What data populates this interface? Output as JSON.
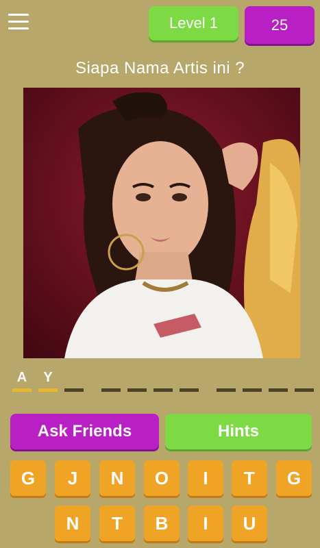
{
  "header": {
    "level_label": "Level 1",
    "coins": "25"
  },
  "question": "Siapa Nama Artis ini ?",
  "answer": {
    "slots": [
      "A",
      "Y",
      "",
      "",
      "",
      "",
      "",
      "",
      "",
      "",
      "",
      ""
    ]
  },
  "buttons": {
    "ask_friends": "Ask Friends",
    "hints": "Hints"
  },
  "keyboard": {
    "row1": [
      "G",
      "J",
      "N",
      "O",
      "I",
      "T",
      "G"
    ],
    "row2": [
      "N",
      "T",
      "B",
      "I",
      "U"
    ]
  },
  "colors": {
    "background": "#b7a76b",
    "green": "#7dd944",
    "purple": "#b81fc4",
    "orange_key": "#f0a426",
    "filled_slot": "#e8b72a"
  }
}
